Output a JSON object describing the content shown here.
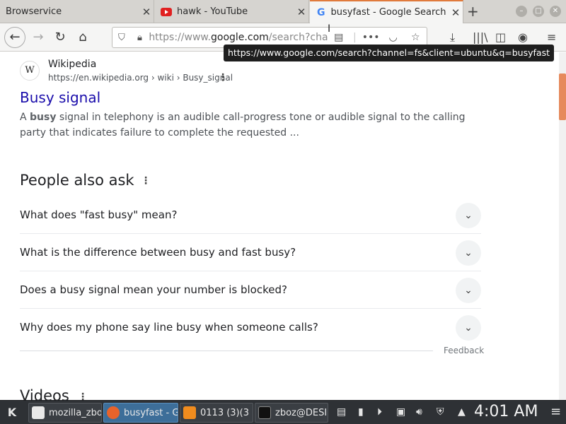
{
  "tabs": [
    {
      "title": "Browservice"
    },
    {
      "title": "hawk - YouTube"
    },
    {
      "title": "busyfast - Google Search"
    }
  ],
  "toolbar": {
    "url_prefix": "https://www.",
    "url_domain": "google.com",
    "url_suffix": "/search?channel=fs&client=ubuntu&q=busyfast"
  },
  "tooltip": "https://www.google.com/search?channel=fs&client=ubuntu&q=busyfast",
  "result": {
    "site_name": "Wikipedia",
    "site_url": "https://en.wikipedia.org › wiki › Busy_signal",
    "title": "Busy signal",
    "snippet_pre": "A ",
    "snippet_bold": "busy",
    "snippet_post": " signal in telephony is an audible call-progress tone or audible signal to the calling party that indicates failure to complete the requested ..."
  },
  "paa": {
    "title": "People also ask",
    "questions": [
      "What does \"fast busy\" mean?",
      "What is the difference between busy and fast busy?",
      "Does a busy signal mean your number is blocked?",
      "Why does my phone say line busy when someone calls?"
    ],
    "feedback": "Feedback"
  },
  "videos_heading": "Videos",
  "taskbar": {
    "tasks": [
      "mozilla_zbo",
      "busyfast - G",
      "0113 (3)(3",
      "zboz@DESI"
    ],
    "clock": "4:01 AM"
  },
  "colors": {
    "link": "#1a0dab",
    "active_tab_accent": "#e07a3c",
    "scroll_thumb": "#e68a5c",
    "taskbar_bg": "#2e3135"
  }
}
